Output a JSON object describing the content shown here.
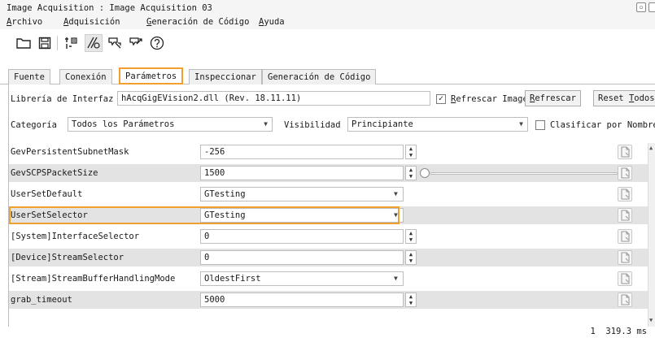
{
  "window": {
    "title": "Image Acquisition : Image Acquisition 03"
  },
  "menu": [
    {
      "label": "Archivo"
    },
    {
      "label": "Adquisición"
    },
    {
      "label": "Generación de Código"
    },
    {
      "label": "Ayuda"
    }
  ],
  "toolbar": {
    "icons": [
      "open-folder-icon",
      "save-icon",
      "connect-icon",
      "live-icon",
      "snap-icon",
      "grab-icon",
      "help-icon"
    ]
  },
  "tabs": [
    {
      "label": "Fuente"
    },
    {
      "label": "Conexión"
    },
    {
      "label": "Parámetros",
      "active": true
    },
    {
      "label": "Inspeccionar"
    },
    {
      "label": "Generación de Código"
    }
  ],
  "params": {
    "library_label": "Librería de Interfaz",
    "library_value": "hAcqGigEVision2.dll (Rev. 18.11.11)",
    "refresh_image_label": "Refrescar Imagen",
    "refresh_image_checked": true,
    "refresh_button": "Refrescar",
    "reset_all_button": "Reset Todos",
    "category_label": "Categoría",
    "category_value": "Todos los Parámetros",
    "visibility_label": "Visibilidad",
    "visibility_value": "Principiante",
    "sort_label": "Clasificar por Nombre",
    "sort_checked": false
  },
  "rows": [
    {
      "name": "GevPersistentSubnetMask",
      "value": "-256",
      "control": "spin"
    },
    {
      "name": "GevSCPSPacketSize",
      "value": "1500",
      "control": "spin-slider"
    },
    {
      "name": "UserSetDefault",
      "value": "GTesting",
      "control": "drop"
    },
    {
      "name": "UserSetSelector",
      "value": "GTesting",
      "control": "drop",
      "highlighted": true
    },
    {
      "name": "[System]InterfaceSelector",
      "value": "0",
      "control": "spin"
    },
    {
      "name": "[Device]StreamSelector",
      "value": "0",
      "control": "spin"
    },
    {
      "name": "[Stream]StreamBufferHandlingMode",
      "value": "OldestFirst",
      "control": "drop"
    },
    {
      "name": "grab_timeout",
      "value": "5000",
      "control": "spin"
    }
  ],
  "status": {
    "text": "1  319.3 ms"
  },
  "colors": {
    "highlight": "#f0a030",
    "alt_row": "#e3e3e3"
  }
}
